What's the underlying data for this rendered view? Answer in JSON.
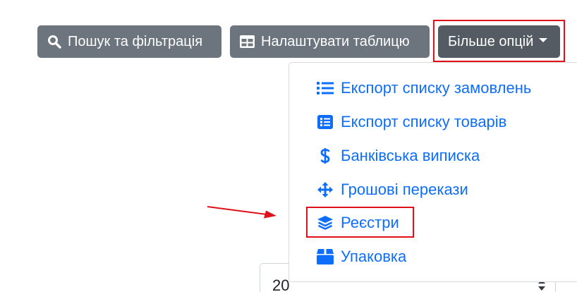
{
  "toolbar": {
    "search_filter_label": "Пошук та фільтрація",
    "configure_table_label": "Налаштувати таблицю",
    "more_options_label": "Більше опцій"
  },
  "dropdown": {
    "items": [
      {
        "label": "Експорт списку замовлень",
        "icon": "list-icon"
      },
      {
        "label": "Експорт списку товарів",
        "icon": "list-alt-icon"
      },
      {
        "label": "Банківська виписка",
        "icon": "dollar-icon"
      },
      {
        "label": "Грошові перекази",
        "icon": "arrows-move-icon"
      },
      {
        "label": "Реєстри",
        "icon": "layers-icon"
      },
      {
        "label": "Упаковка",
        "icon": "box-icon"
      }
    ]
  },
  "page_size_select": {
    "value": "20"
  },
  "colors": {
    "button_gray": "#6c757d",
    "button_active": "#545b62",
    "link_blue": "#0d6efd",
    "annotation_red": "#e0101a"
  }
}
